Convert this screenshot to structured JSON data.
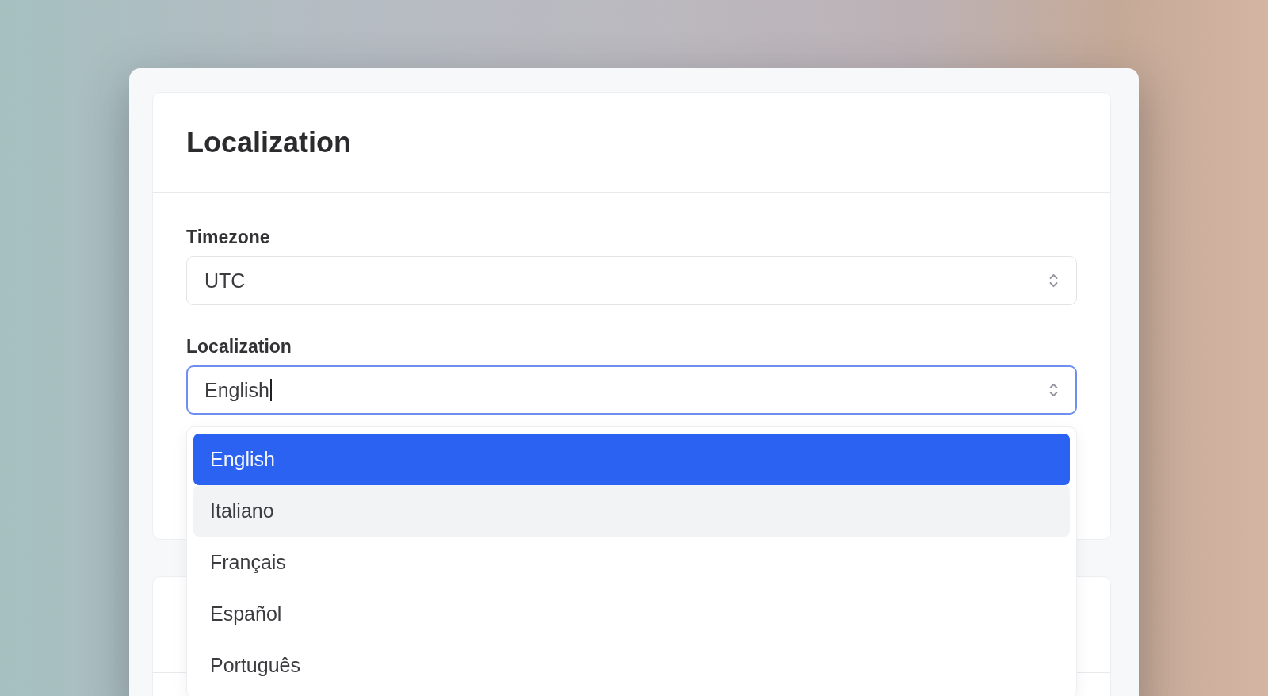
{
  "panel": {
    "title": "Localization",
    "fields": [
      {
        "label": "Timezone",
        "value": "UTC",
        "focused": false
      },
      {
        "label": "Localization",
        "value": "English",
        "focused": true,
        "options": [
          {
            "label": "English",
            "selected": true,
            "hovered": false
          },
          {
            "label": "Italiano",
            "selected": false,
            "hovered": true
          },
          {
            "label": "Français",
            "selected": false,
            "hovered": false
          },
          {
            "label": "Español",
            "selected": false,
            "hovered": false
          },
          {
            "label": "Português",
            "selected": false,
            "hovered": false
          }
        ]
      }
    ]
  }
}
